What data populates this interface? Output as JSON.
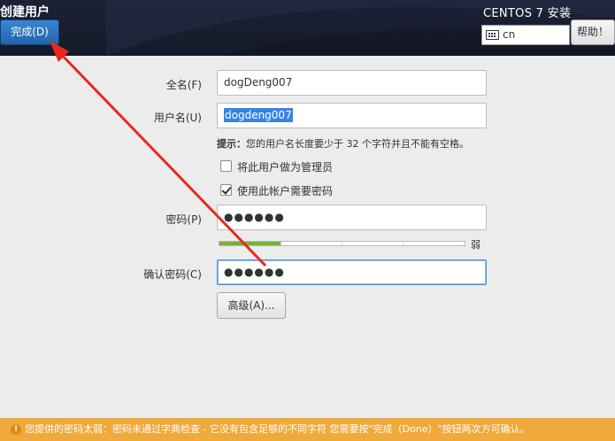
{
  "header": {
    "title": "创建用户",
    "done_button": "完成(D)",
    "product": "CENTOS 7 安装",
    "keyboard_layout": "cn",
    "help_button": "帮助！"
  },
  "form": {
    "fullname_label": "全名(F)",
    "fullname_value": "dogDeng007",
    "username_label": "用户名(U)",
    "username_value": "dogdeng007",
    "hint_prefix": "提示：",
    "hint_text": "您的用户名长度要少于 32 个字符并且不能有空格。",
    "admin_checkbox_label": "将此用户做为管理员",
    "admin_checked": false,
    "require_password_label": "使用此帐户需要密码",
    "require_password_checked": true,
    "password_label": "密码(P)",
    "password_masked": "●●●●●●",
    "strength_fraction": 0.25,
    "strength_text": "弱",
    "confirm_label": "确认密码(C)",
    "confirm_masked": "●●●●●●",
    "advanced_button": "高级(A)..."
  },
  "warning": {
    "icon": "warning-icon",
    "text": "您提供的密码太弱：密码未通过字典检查 - 它没有包含足够的不同字符 您需要按\"完成（Done）\"按钮两次方可确认。"
  },
  "annotation": {
    "color": "#e8281e"
  }
}
